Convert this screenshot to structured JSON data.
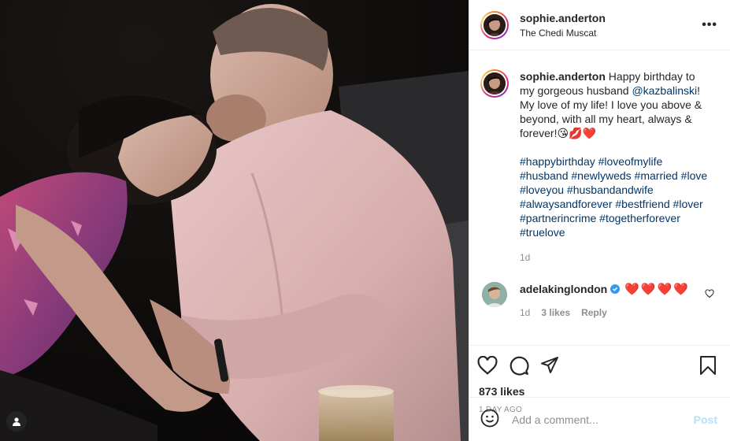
{
  "post": {
    "username": "sophie.anderton",
    "location": "The Chedi Muscat",
    "more_label": "•••"
  },
  "caption": {
    "username": "sophie.anderton",
    "text_before_mention": "Happy birthday to my gorgeous husband",
    "mention": "@kazbalinski",
    "text_after_mention": "! My love of my life! I love you above & beyond, with all my heart, always & forever!",
    "emojis": "😘💋❤️",
    "hashtags": "#happybirthday #loveofmylife #husband #newlyweds #married #love #loveyou #husbandandwife #alwaysandforever #bestfriend #lover #partnerincrime #togetherforever #truelove",
    "age": "1d"
  },
  "comments": [
    {
      "username": "adelakinglondon",
      "verified": true,
      "text": "❤️❤️❤️❤️",
      "age": "1d",
      "likes": "3 likes",
      "reply_label": "Reply"
    }
  ],
  "actions": {
    "likes_count": "873 likes",
    "timestamp": "1 DAY AGO"
  },
  "add_comment": {
    "placeholder": "Add a comment...",
    "post_label": "Post"
  },
  "icons": {
    "like": "heart-outline-icon",
    "comment": "speech-bubble-icon",
    "share": "paper-plane-icon",
    "save": "bookmark-icon",
    "emoji": "smiley-icon",
    "tag": "user-tag-icon",
    "verified": "verified-badge-icon"
  },
  "colors": {
    "link": "#00376b",
    "verified": "#3897f0",
    "post_button_disabled": "#b2dffc",
    "muted": "#8e8e8e"
  }
}
